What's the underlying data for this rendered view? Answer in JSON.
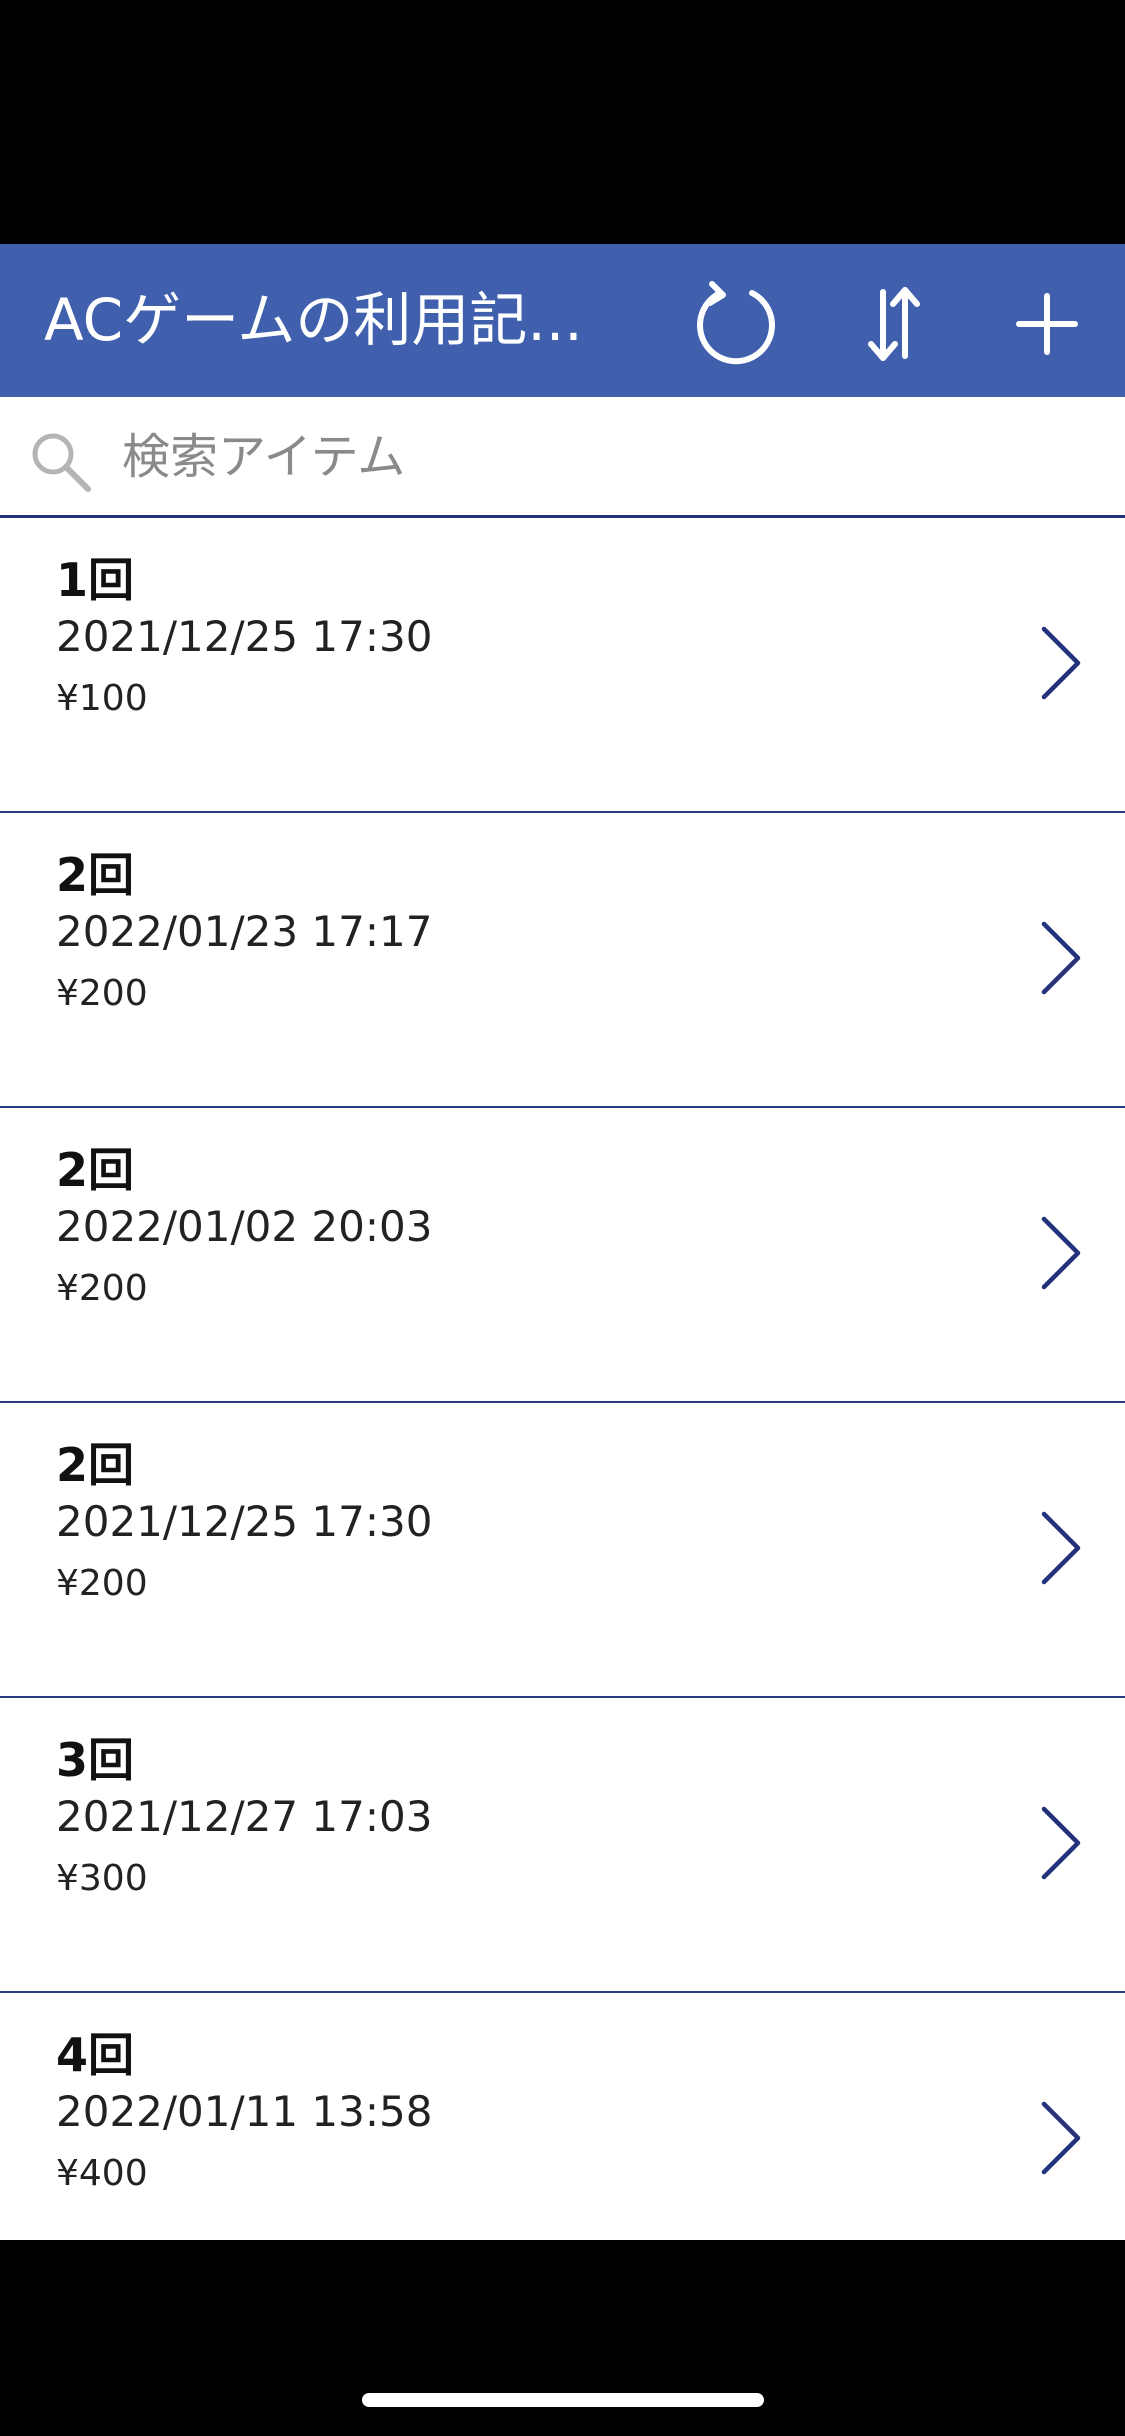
{
  "header": {
    "title": "ACゲームの利用記...",
    "refresh_icon": "refresh-icon",
    "sort_icon": "sort-icon",
    "add_icon": "plus-icon",
    "color": "#4060AE"
  },
  "search": {
    "placeholder": "検索アイテム",
    "value": ""
  },
  "list": {
    "accent_color": "#23327A",
    "items": [
      {
        "title": "1回",
        "date": "2021/12/25 17:30",
        "price": "¥100"
      },
      {
        "title": "2回",
        "date": "2022/01/23 17:17",
        "price": "¥200"
      },
      {
        "title": "2回",
        "date": "2022/01/02 20:03",
        "price": "¥200"
      },
      {
        "title": "2回",
        "date": "2021/12/25 17:30",
        "price": "¥200"
      },
      {
        "title": "3回",
        "date": "2021/12/27 17:03",
        "price": "¥300"
      },
      {
        "title": "4回",
        "date": "2022/01/11 13:58",
        "price": "¥400"
      }
    ]
  }
}
